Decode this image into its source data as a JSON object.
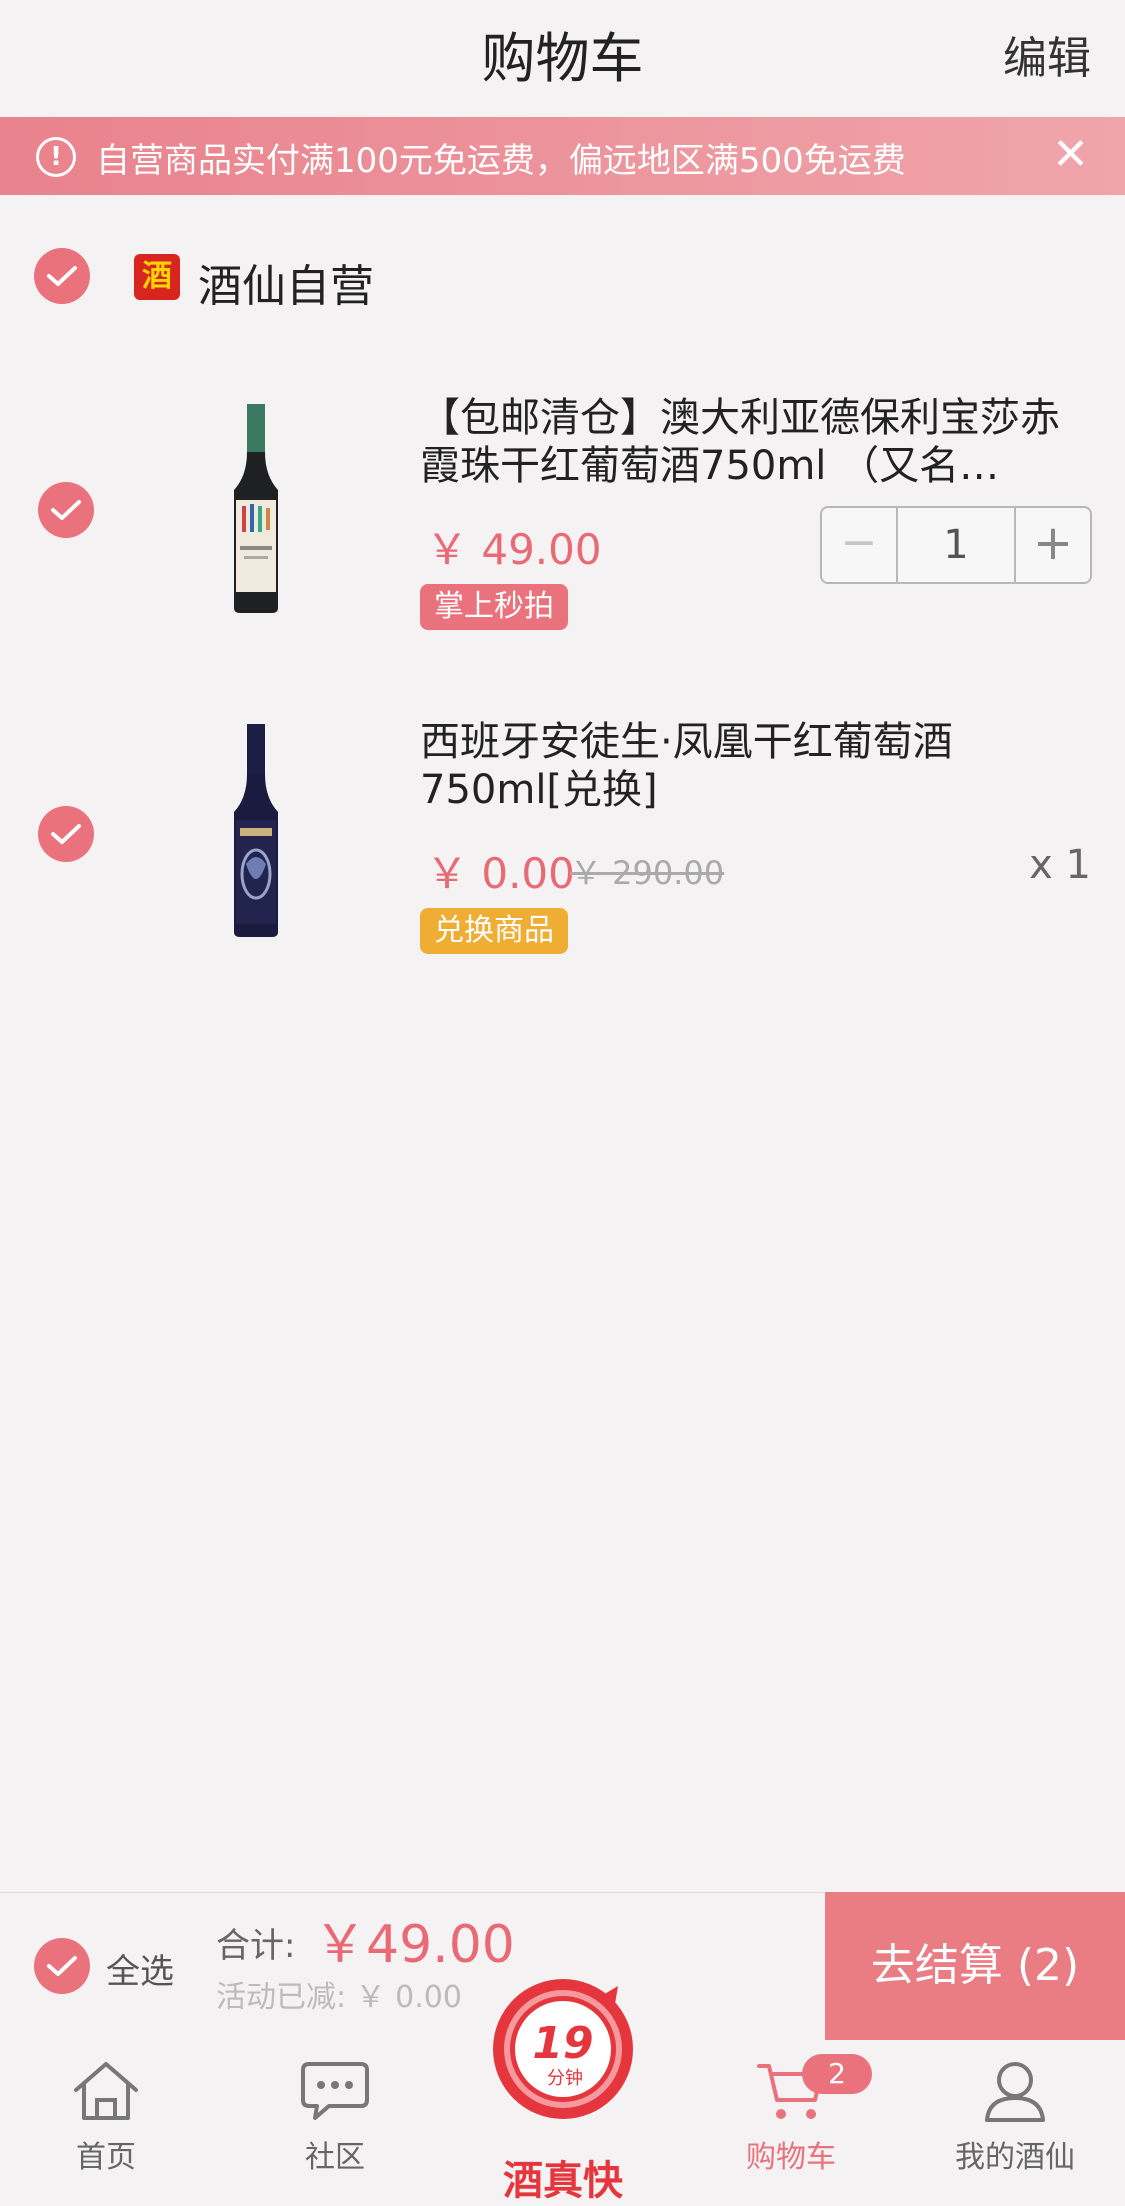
{
  "header": {
    "title": "购物车",
    "edit": "编辑"
  },
  "notice": {
    "text": "自营商品实付满100元免运费，偏远地区满500免运费",
    "close": "✕"
  },
  "shop": {
    "name": "酒仙自营",
    "logo_char": "酒"
  },
  "items": [
    {
      "name": "【包邮清仓】澳大利亚德保利宝莎赤霞珠干红葡萄酒750ml （又名…",
      "price": "￥ 49.00",
      "tag": "掌上秒拍",
      "quantity": "1",
      "minus": "−",
      "plus": "+"
    },
    {
      "name": "西班牙安徒生·凤凰干红葡萄酒750ml[兑换]",
      "price": "￥ 0.00",
      "old_price": "￥ 290.00",
      "tag": "兑换商品",
      "quantity": "x 1"
    }
  ],
  "footer": {
    "select_all": "全选",
    "total_label": "合计:",
    "total_value": "￥49.00",
    "discount": "活动已减: ￥ 0.00",
    "checkout": "去结算 (2)"
  },
  "tabs": [
    {
      "label": "首页",
      "icon": "home-icon"
    },
    {
      "label": "社区",
      "icon": "chat-icon"
    },
    {
      "label": "酒真快",
      "icon": "delivery-19-min-icon",
      "logo_num": "19",
      "logo_sub": "分钟"
    },
    {
      "label": "购物车",
      "icon": "cart-icon",
      "badge": "2"
    },
    {
      "label": "我的酒仙",
      "icon": "user-icon"
    }
  ],
  "colors": {
    "accent": "#e9727c",
    "tag_pink": "#e9727c",
    "tag_orange": "#f0ad33",
    "center_red": "#e5353d"
  }
}
